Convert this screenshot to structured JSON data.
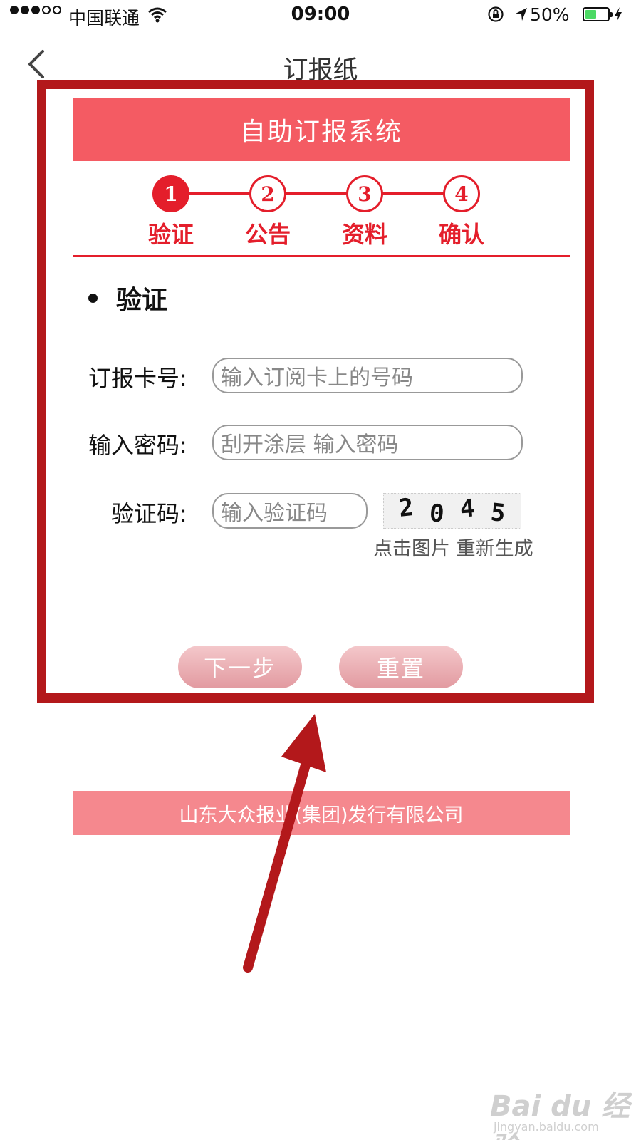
{
  "status_bar": {
    "carrier": "中国联通",
    "time": "09:00",
    "battery_percent": "50%",
    "battery_level": 0.5
  },
  "nav": {
    "title": "订报纸"
  },
  "card": {
    "header_title": "自助订报系统",
    "steps": [
      {
        "number": "1",
        "label": "验证",
        "active": true
      },
      {
        "number": "2",
        "label": "公告",
        "active": false
      },
      {
        "number": "3",
        "label": "资料",
        "active": false
      },
      {
        "number": "4",
        "label": "确认",
        "active": false
      }
    ],
    "section_title": "验证",
    "form": {
      "card_label": "订报卡号:",
      "card_placeholder": "输入订阅卡上的号码",
      "password_label": "输入密码:",
      "password_placeholder": "刮开涂层 输入密码",
      "captcha_label": "验证码:",
      "captcha_placeholder": "输入验证码",
      "captcha_chars": [
        "2",
        "0",
        "4",
        "5"
      ],
      "captcha_hint": "点击图片 重新生成"
    },
    "buttons": {
      "next": "下一步",
      "reset": "重置"
    }
  },
  "footer": {
    "company": "山东大众报业(集团)发行有限公司"
  },
  "watermark": {
    "brand": "Bai du 经验",
    "url": "jingyan.baidu.com"
  },
  "colors": {
    "accent": "#e41e2b",
    "header_bg": "#f45b63",
    "footer_bg": "#f5888e",
    "annotation": "#b3181b"
  }
}
